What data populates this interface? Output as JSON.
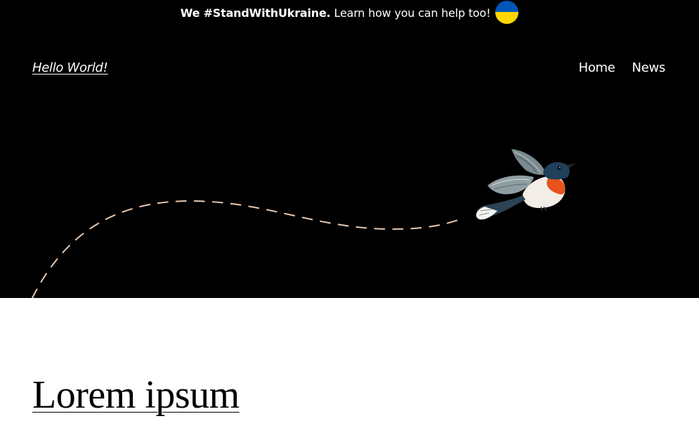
{
  "banner": {
    "strong_text": "We #StandWithUkraine.",
    "text": "Learn how you can help too!",
    "flag_colors": {
      "top": "#0057b7",
      "bottom": "#ffd700"
    },
    "icon": "ukraine-flag-icon"
  },
  "header": {
    "site_title": "Hello World!",
    "nav": [
      {
        "label": "Home"
      },
      {
        "label": "News"
      }
    ]
  },
  "hero": {
    "background": "#000000",
    "path_color": "#e8c9b0",
    "illustration": "bird-illustration"
  },
  "main": {
    "post_title": "Lorem ipsum"
  }
}
